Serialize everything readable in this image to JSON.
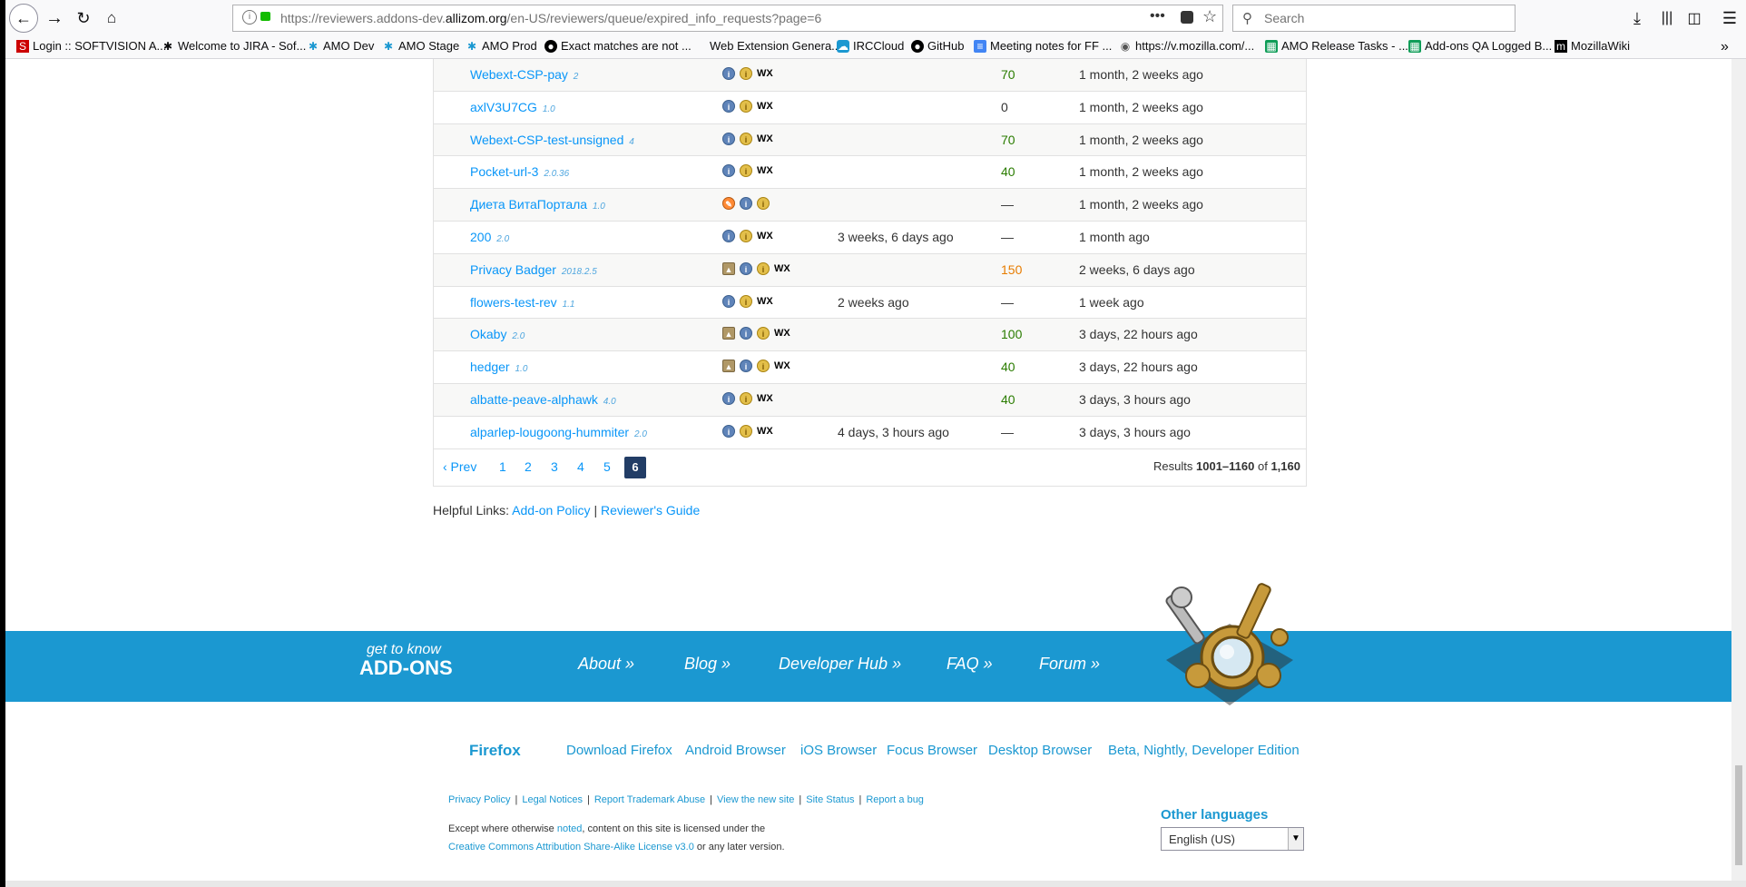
{
  "browser": {
    "url_prefix": "https://reviewers.addons-dev.",
    "url_domain": "allizom.org",
    "url_suffix": "/en-US/reviewers/queue/expired_info_requests?page=6",
    "search_placeholder": "Search"
  },
  "bookmarks": [
    {
      "label": "Login :: SOFTVISION A...",
      "icon": "softvision-icon"
    },
    {
      "label": "Welcome to JIRA - Sof...",
      "icon": "jira-icon"
    },
    {
      "label": "AMO Dev",
      "icon": "amo-icon"
    },
    {
      "label": "AMO Stage",
      "icon": "amo-icon"
    },
    {
      "label": "AMO Prod",
      "icon": "amo-icon"
    },
    {
      "label": "Exact matches are not ...",
      "icon": "github-icon"
    },
    {
      "label": "Web Extension Genera...",
      "icon": "blank-icon"
    },
    {
      "label": "IRCCloud",
      "icon": "irccloud-icon"
    },
    {
      "label": "GitHub",
      "icon": "github-icon"
    },
    {
      "label": "Meeting notes for FF ...",
      "icon": "doc-icon"
    },
    {
      "label": "https://v.mozilla.com/...",
      "icon": "globe-icon"
    },
    {
      "label": "AMO Release Tasks - ...",
      "icon": "sheet-icon"
    },
    {
      "label": "Add-ons QA Logged B...",
      "icon": "sheet-icon"
    },
    {
      "label": "MozillaWiki",
      "icon": "wiki-icon"
    }
  ],
  "queue": {
    "rows": [
      {
        "name": "Webext-CSP-pay",
        "version": "2",
        "flags": [
          "info",
          "pending",
          "wx"
        ],
        "time": "",
        "score": "70",
        "score_color": "green",
        "date": "1 month, 2 weeks ago"
      },
      {
        "name": "axlV3U7CG",
        "version": "1.0",
        "flags": [
          "info",
          "pending",
          "wx"
        ],
        "time": "",
        "score": "0",
        "score_color": "black",
        "date": "1 month, 2 weeks ago"
      },
      {
        "name": "Webext-CSP-test-unsigned",
        "version": "4",
        "flags": [
          "info",
          "pending",
          "wx"
        ],
        "time": "",
        "score": "70",
        "score_color": "green",
        "date": "1 month, 2 weeks ago"
      },
      {
        "name": "Pocket-url-3",
        "version": "2.0.36",
        "flags": [
          "info",
          "pending",
          "wx"
        ],
        "time": "",
        "score": "40",
        "score_color": "green",
        "date": "1 month, 2 weeks ago"
      },
      {
        "name": "Диета ВитаПортала",
        "version": "1.0",
        "flags": [
          "theme",
          "info",
          "pending"
        ],
        "time": "",
        "score": "—",
        "score_color": "black",
        "date": "1 month, 2 weeks ago"
      },
      {
        "name": "200",
        "version": "2.0",
        "flags": [
          "info",
          "pending",
          "wx"
        ],
        "time": "3 weeks, 6 days ago",
        "score": "—",
        "score_color": "black",
        "date": "1 month ago"
      },
      {
        "name": "Privacy Badger",
        "version": "2018.2.5",
        "flags": [
          "lock",
          "info",
          "pending",
          "wx"
        ],
        "time": "",
        "score": "150",
        "score_color": "orange",
        "date": "2 weeks, 6 days ago"
      },
      {
        "name": "flowers-test-rev",
        "version": "1.1",
        "flags": [
          "info",
          "pending",
          "wx"
        ],
        "time": "2 weeks ago",
        "score": "—",
        "score_color": "black",
        "date": "1 week ago"
      },
      {
        "name": "Okaby",
        "version": "2.0",
        "flags": [
          "lock",
          "info",
          "pending",
          "wx"
        ],
        "time": "",
        "score": "100",
        "score_color": "green",
        "date": "3 days, 22 hours ago"
      },
      {
        "name": "hedger",
        "version": "1.0",
        "flags": [
          "lock",
          "info",
          "pending",
          "wx"
        ],
        "time": "",
        "score": "40",
        "score_color": "green",
        "date": "3 days, 22 hours ago"
      },
      {
        "name": "albatte-peave-alphawk",
        "version": "4.0",
        "flags": [
          "info",
          "pending",
          "wx"
        ],
        "time": "",
        "score": "40",
        "score_color": "green",
        "date": "3 days, 3 hours ago"
      },
      {
        "name": "alparlep-lougoong-hummiter",
        "version": "2.0",
        "flags": [
          "info",
          "pending",
          "wx"
        ],
        "time": "4 days, 3 hours ago",
        "score": "—",
        "score_color": "black",
        "date": "3 days, 3 hours ago"
      }
    ],
    "wx_label": "WX"
  },
  "pager": {
    "prev_label": "‹ Prev",
    "pages": [
      "1",
      "2",
      "3",
      "4",
      "5"
    ],
    "current": "6",
    "results_prefix": "Results ",
    "results_range": "1001–1160",
    "results_of": " of ",
    "results_total": "1,160"
  },
  "helpful": {
    "label": "Helpful Links: ",
    "link1": "Add-on Policy",
    "sep": " | ",
    "link2": "Reviewer's Guide"
  },
  "footer": {
    "gtk_small": "get to know",
    "gtk_big": "ADD-ONS",
    "links": [
      "About »",
      "Blog »",
      "Developer Hub »",
      "FAQ »",
      "Forum »"
    ],
    "firefox_title": "Firefox",
    "firefox_links": [
      "Download Firefox",
      "Android Browser",
      "iOS Browser",
      "Focus Browser",
      "Desktop Browser",
      "Beta, Nightly, Developer Edition"
    ],
    "legal_links": [
      "Privacy Policy",
      "Legal Notices",
      "Report Trademark Abuse",
      "View the new site",
      "Site Status",
      "Report a bug"
    ],
    "license_pre": "Except where otherwise ",
    "license_noted": "noted",
    "license_mid": ", content on this site is licensed under the",
    "license_link": "Creative Commons Attribution Share-Alike License v3.0",
    "license_post": " or any later version.",
    "other_languages": "Other languages",
    "language_value": "English (US)"
  }
}
